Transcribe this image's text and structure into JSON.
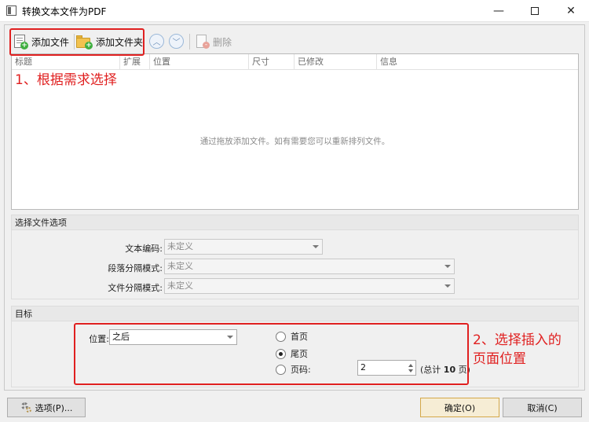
{
  "window": {
    "title": "转换文本文件为PDF",
    "minimize_glyph": "—",
    "close_glyph": "✕"
  },
  "toolbar": {
    "add_file": "添加文件",
    "add_folder": "添加文件夹",
    "move_up_glyph": "︿",
    "move_down_glyph": "﹀",
    "delete": "删除"
  },
  "file_list": {
    "columns": [
      "标题",
      "扩展",
      "位置",
      "尺寸",
      "已修改",
      "信息"
    ],
    "empty_text": "通过拖放添加文件。如有需要您可以重新排列文件。"
  },
  "file_options": {
    "title": "选择文件选项",
    "text_encoding_label": "文本编码:",
    "text_encoding_value": "未定义",
    "paragraph_sep_label": "段落分隔模式:",
    "paragraph_sep_value": "未定义",
    "file_sep_label": "文件分隔模式:",
    "file_sep_value": "未定义"
  },
  "target": {
    "title": "目标",
    "position_label": "位置:",
    "position_value": "之后",
    "options": [
      "首页",
      "尾页",
      "页码:"
    ],
    "selected_option": "尾页",
    "page_number": "2",
    "total_prefix": "(总计 ",
    "total_pages": "10",
    "total_suffix": " 页)"
  },
  "annotations": {
    "step1": "1、根据需求选择",
    "step2_line1": "2、选择插入的",
    "step2_line2": "页面位置",
    "color": "#e02020"
  },
  "buttons": {
    "options": "选项(P)...",
    "ok": "确定(O)",
    "cancel": "取消(C)"
  },
  "icons": [
    "app-icon",
    "add-file-icon",
    "add-folder-icon",
    "move-up-icon",
    "move-down-icon",
    "delete-icon",
    "gear-icon"
  ]
}
